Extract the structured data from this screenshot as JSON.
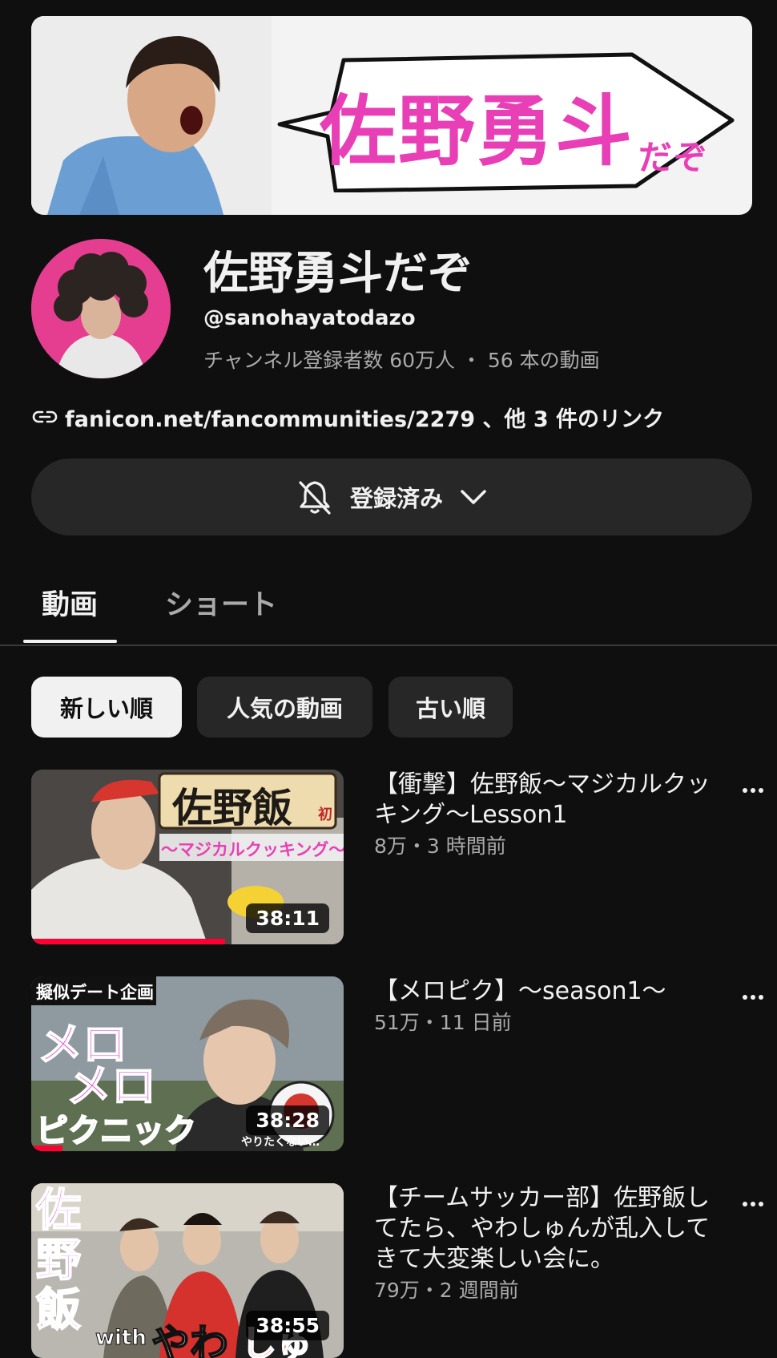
{
  "banner": {
    "text": "佐野勇斗",
    "text_small": "だぞ"
  },
  "channel": {
    "name": "佐野勇斗だぞ",
    "handle": "@sanohayatodazo",
    "meta": "チャンネル登録者数 60万人 ・ 56 本の動画",
    "links": "fanicon.net/fancommunities/2279 、他 3 件のリンク"
  },
  "subscribe": {
    "label": "登録済み"
  },
  "tabs": [
    {
      "label": "動画",
      "active": true
    },
    {
      "label": "ショート",
      "active": false
    }
  ],
  "chips": [
    {
      "label": "新しい順",
      "active": true
    },
    {
      "label": "人気の動画",
      "active": false
    },
    {
      "label": "古い順",
      "active": false
    }
  ],
  "videos": [
    {
      "title": "【衝撃】佐野飯～マジカルクッキング～Lesson1",
      "meta": "8万・3 時間前",
      "duration": "38:11",
      "watched": 0.62,
      "thumb_text": "佐野飯",
      "thumb_sub": "～マジカルクッキング～",
      "thumb_badge": "初"
    },
    {
      "title": "【メロピク】～season1～",
      "meta": "51万・11 日前",
      "duration": "38:28",
      "watched": 0.1,
      "thumb_tag": "擬似デート企画",
      "thumb_line1": "メロ",
      "thumb_line2": "メロ",
      "thumb_line3": "ピクニック",
      "thumb_caption": "やりたくない…"
    },
    {
      "title": "【チームサッカー部】佐野飯してたら、やわしゅんが乱入してきて大変楽しい会に。",
      "meta": "79万・2 週間前",
      "duration": "38:55",
      "watched": 0,
      "thumb_text": "佐野飯",
      "thumb_with": "with",
      "thumb_name1": "やわ",
      "thumb_name2": "しゅん"
    }
  ],
  "colors": {
    "accent": "#e93fb6",
    "background": "#0f0f0f",
    "chip": "#272727",
    "progress": "#ff0033"
  }
}
